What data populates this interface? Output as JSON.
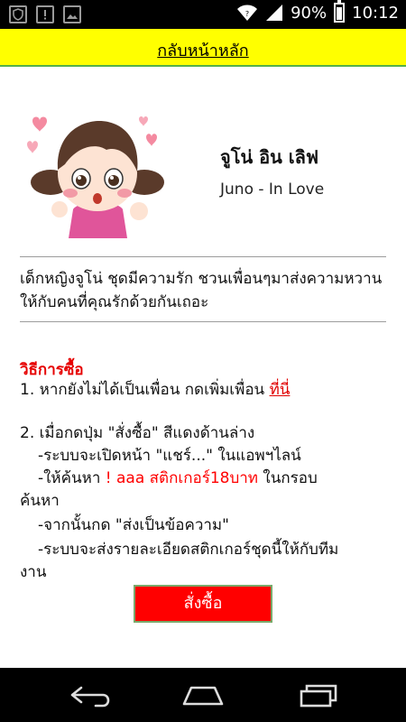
{
  "status_bar": {
    "battery_text": "90%",
    "time": "10:12"
  },
  "header": {
    "back_link": "กลับหน้าหลัก"
  },
  "sticker": {
    "title_th": "จูโน่ อิน เลิฟ",
    "title_en": "Juno - In Love"
  },
  "description": "เด็กหญิงจูโน่ ชุดมีความรัก ชวนเพื่อนๆมาส่งความหวานให้กับคนที่คุณรักด้วยกันเถอะ",
  "howto": {
    "title": "วิธีการซื้อ",
    "step1_prefix": "1. หากยังไม่ได้เป็นเพื่อน กดเพิ่มเพื่อน ",
    "step1_link": "ที่นี่",
    "step2_line1": "2. เมื่อกดปุ่ม \"สั่งซื้อ\" สีแดงด้านล่าง",
    "step2_line2": "-ระบบจะเปิดหน้า \"แชร์...\" ในแอพฯไลน์",
    "step2_line3_prefix": "-ให้ค้นหา ",
    "step2_line3_highlight": "! aaa สติกเกอร์18บาท",
    "step2_line3_suffix": " ในกรอบ",
    "step2_line4": "ค้นหา",
    "step2_line5": "-จากนั้นกด \"ส่งเป็นข้อความ\"",
    "step2_line6": "-ระบบจะส่งรายละเอียดสติกเกอร์ชุดนี้ให้กับทีม",
    "step2_line7": "งาน"
  },
  "order_button": "สั่งซื้อ",
  "icons": {
    "status_left": [
      "shield-icon",
      "alert-icon",
      "image-icon"
    ],
    "status_right": [
      "wifi-icon",
      "signal-icon",
      "battery-icon"
    ],
    "nav": [
      "back-icon",
      "home-icon",
      "recent-apps-icon"
    ]
  },
  "colors": {
    "header_bg": "#ffff00",
    "accent_red": "#ff0000",
    "header_border": "#55b04a"
  }
}
